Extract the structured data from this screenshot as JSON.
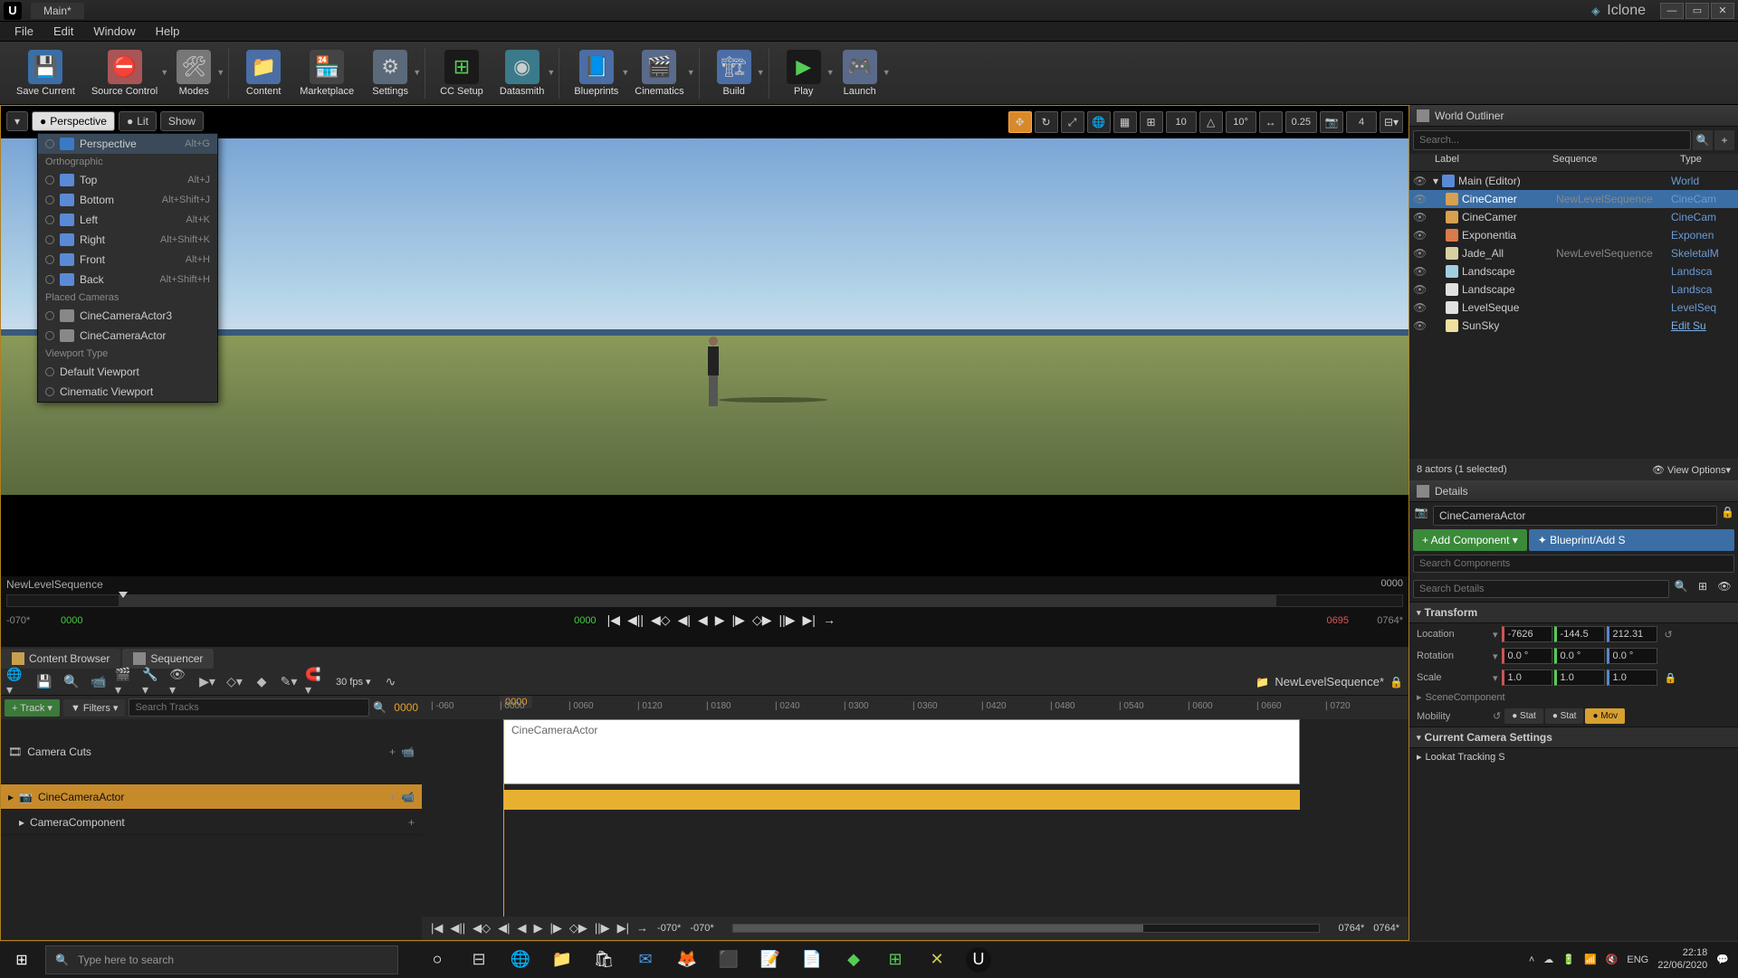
{
  "titlebar": {
    "tab": "Main*",
    "project": "Iclone"
  },
  "menubar": [
    "File",
    "Edit",
    "Window",
    "Help"
  ],
  "toolbar": [
    {
      "id": "save",
      "label": "Save Current",
      "cls": "ic-save",
      "glyph": "💾"
    },
    {
      "id": "source",
      "label": "Source Control",
      "cls": "ic-src",
      "glyph": "⛔",
      "dd": true
    },
    {
      "id": "modes",
      "label": "Modes",
      "cls": "ic-modes",
      "glyph": "🛠",
      "dd": true,
      "sep": true
    },
    {
      "id": "content",
      "label": "Content",
      "cls": "ic-content",
      "glyph": "📁"
    },
    {
      "id": "market",
      "label": "Marketplace",
      "cls": "ic-market",
      "glyph": "🏪"
    },
    {
      "id": "settings",
      "label": "Settings",
      "cls": "ic-settings",
      "glyph": "⚙",
      "dd": true,
      "sep": true
    },
    {
      "id": "cc",
      "label": "CC Setup",
      "cls": "ic-cc",
      "glyph": "⊞"
    },
    {
      "id": "datasmith",
      "label": "Datasmith",
      "cls": "ic-datasmith",
      "glyph": "◉",
      "dd": true,
      "sep": true
    },
    {
      "id": "bp",
      "label": "Blueprints",
      "cls": "ic-bp",
      "glyph": "📘",
      "dd": true
    },
    {
      "id": "cine",
      "label": "Cinematics",
      "cls": "ic-cine",
      "glyph": "🎬",
      "dd": true,
      "sep": true
    },
    {
      "id": "build",
      "label": "Build",
      "cls": "ic-build",
      "glyph": "🏗",
      "dd": true,
      "sep": true
    },
    {
      "id": "play",
      "label": "Play",
      "cls": "ic-play",
      "glyph": "▶",
      "dd": true
    },
    {
      "id": "launch",
      "label": "Launch",
      "cls": "ic-launch",
      "glyph": "🎮",
      "dd": true
    }
  ],
  "viewport": {
    "dd_perspective": "Perspective",
    "dd_lit": "Lit",
    "dd_show": "Show",
    "snap_angle": "10",
    "snap_rot": "10°",
    "snap_scale": "0.25",
    "cam_speed": "4",
    "menu": {
      "perspective": {
        "label": "Perspective",
        "shortcut": "Alt+G"
      },
      "ortho_header": "Orthographic",
      "ortho": [
        {
          "label": "Top",
          "shortcut": "Alt+J"
        },
        {
          "label": "Bottom",
          "shortcut": "Alt+Shift+J"
        },
        {
          "label": "Left",
          "shortcut": "Alt+K"
        },
        {
          "label": "Right",
          "shortcut": "Alt+Shift+K"
        },
        {
          "label": "Front",
          "shortcut": "Alt+H"
        },
        {
          "label": "Back",
          "shortcut": "Alt+Shift+H"
        }
      ],
      "placed_header": "Placed Cameras",
      "placed": [
        "CineCameraActor3",
        "CineCameraActor"
      ],
      "vptype_header": "Viewport Type",
      "vptype": [
        "Default Viewport",
        "Cinematic Viewport"
      ]
    },
    "seq_name": "NewLevelSequence",
    "seq_right": "0000",
    "frame_start": "-070*",
    "frame_in": "0000",
    "frame_cur": "0000",
    "frame_out": "0695",
    "frame_end": "0764*"
  },
  "tabs": {
    "content_browser": "Content Browser",
    "sequencer": "Sequencer"
  },
  "sequencer": {
    "fps": "30 fps",
    "asset": "NewLevelSequence*",
    "add_track": "+ Track",
    "filters": "Filters",
    "search_placeholder": "Search Tracks",
    "curframe": "0000",
    "playhead": "0000",
    "ticks": [
      "-060",
      "0000",
      "0060",
      "0120",
      "0180",
      "0240",
      "0300",
      "0360",
      "0420",
      "0480",
      "0540",
      "0600",
      "0660",
      "0720"
    ],
    "tracks": {
      "camera_cuts": "Camera Cuts",
      "cine_actor": "CineCameraActor",
      "camera_comp": "CameraComponent",
      "clip_label": "CineCameraActor"
    },
    "bottom": {
      "start": "-070*",
      "in": "-070*",
      "out": "0764*",
      "end": "0764*"
    }
  },
  "outliner": {
    "title": "World Outliner",
    "search_placeholder": "Search...",
    "columns": {
      "label": "Label",
      "sequence": "Sequence",
      "type": "Type"
    },
    "rows": [
      {
        "icon": "oi-world",
        "label": "Main (Editor)",
        "seq": "",
        "type": "World",
        "indent": 0
      },
      {
        "icon": "oi-cam",
        "label": "CineCamer",
        "seq": "NewLevelSequence",
        "type": "CineCam",
        "sel": true,
        "indent": 1
      },
      {
        "icon": "oi-cam",
        "label": "CineCamer",
        "seq": "",
        "type": "CineCam",
        "indent": 1
      },
      {
        "icon": "oi-fog",
        "label": "Exponentia",
        "seq": "",
        "type": "Exponen",
        "indent": 1
      },
      {
        "icon": "oi-char",
        "label": "Jade_All",
        "seq": "NewLevelSequence",
        "type": "SkeletalM",
        "indent": 1
      },
      {
        "icon": "oi-land",
        "label": "Landscape",
        "seq": "",
        "type": "Landsca",
        "indent": 1
      },
      {
        "icon": "oi-seq",
        "label": "Landscape",
        "seq": "",
        "type": "Landsca",
        "indent": 1
      },
      {
        "icon": "oi-seq",
        "label": "LevelSeque",
        "seq": "",
        "type": "LevelSeq",
        "indent": 1
      },
      {
        "icon": "oi-sun",
        "label": "SunSky",
        "seq": "",
        "type": "Edit Su",
        "link": true,
        "indent": 1
      }
    ],
    "footer": {
      "count": "8 actors (1 selected)",
      "view": "View Options"
    }
  },
  "details": {
    "title": "Details",
    "actor_name": "CineCameraActor",
    "add_component": "+ Add Component",
    "blueprint": "Blueprint/Add S",
    "search_components": "Search Components",
    "search_details": "Search Details",
    "transform": {
      "header": "Transform",
      "location": {
        "label": "Location",
        "x": "-7626",
        "y": "-144.5",
        "z": "212.31"
      },
      "rotation": {
        "label": "Rotation",
        "x": "0.0 °",
        "y": "0.0 °",
        "z": "0.0 °"
      },
      "scale": {
        "label": "Scale",
        "x": "1.0",
        "y": "1.0",
        "z": "1.0"
      },
      "scenecomp": "SceneComponent",
      "mobility": {
        "label": "Mobility",
        "opts": [
          "Stat",
          "Stat",
          "Mov"
        ],
        "sel": 2
      }
    },
    "camera_header": "Current Camera Settings",
    "lookat": "Lookat Tracking S"
  },
  "taskbar": {
    "search_placeholder": "Type here to search",
    "tray": {
      "lang": "ENG",
      "time": "22:18",
      "date": "22/06/2020"
    }
  }
}
